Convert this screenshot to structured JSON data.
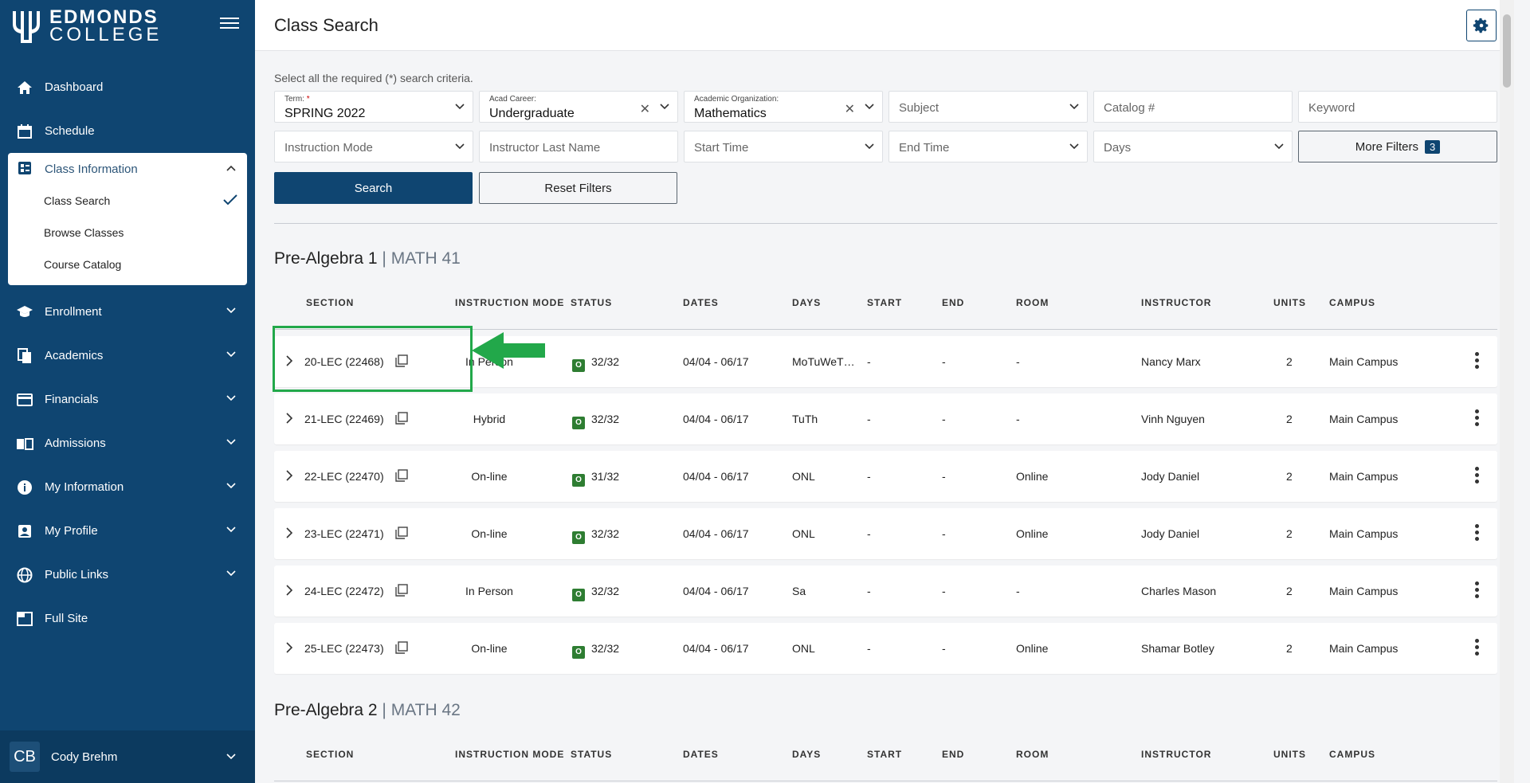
{
  "app": {
    "logo_line1": "EDMONDS",
    "logo_line2": "COLLEGE"
  },
  "sidebar": {
    "items": [
      {
        "label": "Dashboard",
        "icon": "home-icon"
      },
      {
        "label": "Schedule",
        "icon": "calendar-icon"
      }
    ],
    "class_info": {
      "label": "Class Information",
      "subitems": [
        {
          "label": "Class Search",
          "selected": true
        },
        {
          "label": "Browse Classes"
        },
        {
          "label": "Course Catalog"
        }
      ]
    },
    "items2": [
      {
        "label": "Enrollment",
        "icon": "graduation-cap-icon"
      },
      {
        "label": "Academics",
        "icon": "documents-icon"
      },
      {
        "label": "Financials",
        "icon": "credit-card-icon"
      },
      {
        "label": "Admissions",
        "icon": "book-icon"
      },
      {
        "label": "My Information",
        "icon": "info-icon"
      },
      {
        "label": "My Profile",
        "icon": "profile-icon"
      },
      {
        "label": "Public Links",
        "icon": "globe-icon"
      },
      {
        "label": "Full Site",
        "icon": "window-icon"
      }
    ],
    "user": {
      "initials": "CB",
      "name": "Cody Brehm"
    }
  },
  "header": {
    "title": "Class Search"
  },
  "search": {
    "instructions": "Select all the required (*) search criteria.",
    "term_label": "Term:",
    "term_required": "*",
    "term_value": "SPRING 2022",
    "career_label": "Acad Career:",
    "career_value": "Undergraduate",
    "org_label": "Academic Organization:",
    "org_value": "Mathematics",
    "subject_ph": "Subject",
    "catalog_ph": "Catalog #",
    "keyword_ph": "Keyword",
    "mode_ph": "Instruction Mode",
    "instructor_ph": "Instructor Last Name",
    "start_ph": "Start Time",
    "end_ph": "End Time",
    "days_ph": "Days",
    "more_filters": "More Filters",
    "more_filters_count": "3",
    "search_btn": "Search",
    "reset_btn": "Reset Filters"
  },
  "courses": [
    {
      "title": "Pre-Algebra 1",
      "sep": " | ",
      "code": "MATH 41"
    },
    {
      "title": "Pre-Algebra 2",
      "sep": " | ",
      "code": "MATH 42"
    }
  ],
  "columns": [
    "SECTION",
    "INSTRUCTION MODE",
    "STATUS",
    "DATES",
    "DAYS",
    "START",
    "END",
    "ROOM",
    "INSTRUCTOR",
    "UNITS",
    "CAMPUS"
  ],
  "rows": [
    {
      "section": "20-LEC (22468)",
      "mode": "In Person",
      "status": "O",
      "seats": "32/32",
      "dates": "04/04 - 06/17",
      "days": "MoTuWeT…",
      "start": "-",
      "end": "-",
      "room": "-",
      "instructor": "Nancy Marx",
      "units": "2",
      "campus": "Main Campus"
    },
    {
      "section": "21-LEC (22469)",
      "mode": "Hybrid",
      "status": "O",
      "seats": "32/32",
      "dates": "04/04 - 06/17",
      "days": "TuTh",
      "start": "-",
      "end": "-",
      "room": "-",
      "instructor": "Vinh Nguyen",
      "units": "2",
      "campus": "Main Campus"
    },
    {
      "section": "22-LEC (22470)",
      "mode": "On-line",
      "status": "O",
      "seats": "31/32",
      "dates": "04/04 - 06/17",
      "days": "ONL",
      "start": "-",
      "end": "-",
      "room": "Online",
      "instructor": "Jody Daniel",
      "units": "2",
      "campus": "Main Campus"
    },
    {
      "section": "23-LEC (22471)",
      "mode": "On-line",
      "status": "O",
      "seats": "32/32",
      "dates": "04/04 - 06/17",
      "days": "ONL",
      "start": "-",
      "end": "-",
      "room": "Online",
      "instructor": "Jody Daniel",
      "units": "2",
      "campus": "Main Campus"
    },
    {
      "section": "24-LEC (22472)",
      "mode": "In Person",
      "status": "O",
      "seats": "32/32",
      "dates": "04/04 - 06/17",
      "days": "Sa",
      "start": "-",
      "end": "-",
      "room": "-",
      "instructor": "Charles Mason",
      "units": "2",
      "campus": "Main Campus"
    },
    {
      "section": "25-LEC (22473)",
      "mode": "On-line",
      "status": "O",
      "seats": "32/32",
      "dates": "04/04 - 06/17",
      "days": "ONL",
      "start": "-",
      "end": "-",
      "room": "Online",
      "instructor": "Shamar Botley",
      "units": "2",
      "campus": "Main Campus"
    }
  ],
  "colors": {
    "brand": "#0f4571",
    "status_open": "#2e7d32",
    "highlight": "#22a84a"
  }
}
